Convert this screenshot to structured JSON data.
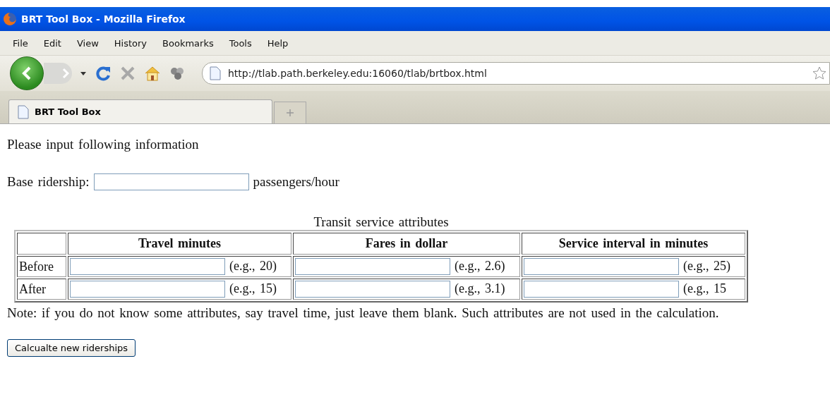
{
  "window": {
    "title": "BRT Tool Box - Mozilla Firefox"
  },
  "menu": [
    "File",
    "Edit",
    "View",
    "History",
    "Bookmarks",
    "Tools",
    "Help"
  ],
  "address": {
    "value": "http://tlab.path.berkeley.edu:16060/tlab/brtbox.html"
  },
  "tabs": [
    {
      "label": "BRT Tool Box",
      "selected": true
    }
  ],
  "page": {
    "intro": "Please input following information",
    "base_label": "Base ridership:",
    "base_unit": "passengers/hour",
    "table": {
      "caption": "Transit service attributes",
      "columns": [
        "Travel minutes",
        "Fares in dollar",
        "Service interval in minutes"
      ],
      "rows": [
        {
          "label": "Before",
          "hints": [
            "(e.g., 20)",
            "(e.g., 2.6)",
            "(e.g., 25)"
          ]
        },
        {
          "label": "After",
          "hints": [
            "(e.g., 15)",
            "(e.g., 3.1)",
            "(e.g., 15"
          ]
        }
      ]
    },
    "note": "Note: if you do not know some attributes, say travel time, just leave them blank. Such attributes are not used in the calculation.",
    "button": "Calcualte new riderships"
  }
}
